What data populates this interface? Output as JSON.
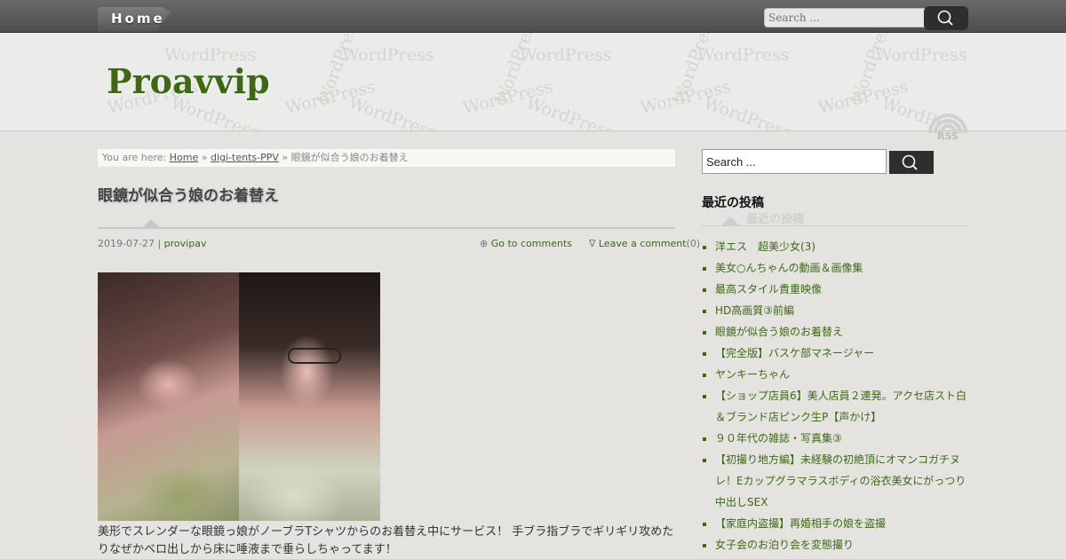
{
  "nav": {
    "home_label": "Home"
  },
  "top_search": {
    "placeholder": "Search ..."
  },
  "site": {
    "title": "Proavvip",
    "watermark": "WordPress",
    "rss_label": "RSS"
  },
  "breadcrumb": {
    "prefix": "You are here:",
    "home": "Home",
    "sep1": "»",
    "category": "digi-tents-PPV",
    "sep2": "»",
    "current": "眼鏡が似合う娘のお着替え"
  },
  "post": {
    "title": "眼鏡が似合う娘のお着替え",
    "date": "2019-07-27",
    "date_sep": "|",
    "author": "provipav",
    "goto_comments": "Go to comments",
    "leave_comment": "Leave a comment",
    "comment_count": "(0)",
    "body": "美形でスレンダーな眼鏡っ娘がノーブラTシャツからのお着替え中にサービス！ 手ブラ指ブラでギリギリ攻めたりなぜかベロ出しから床に唾液まで垂らしちゃってます！"
  },
  "sidebar": {
    "search_value": "Search ...",
    "recent_heading": "最近の投稿",
    "recent_heading_ghost": "最近の投稿",
    "recent_posts": [
      "洋エス　超美少女(3)",
      "美女○んちゃんの動画＆画像集",
      "最高スタイル貴重映像",
      "HD高画質③前編",
      "眼鏡が似合う娘のお着替え",
      "【完全版】バスケ部マネージャー",
      "ヤンキーちゃん",
      "【ショップ店員6】美人店員２連発。アクセ店スト白＆ブランド店ピンク生P【声かけ】",
      "９０年代の雑誌・写真集③",
      "【初撮り地方編】未経験の初絶頂にオマンコガチヌレ！Eカップグラマラスボディの浴衣美女にがっつり中出しSEX",
      "【家庭内盗撮】再婚相手の娘を盗撮",
      "女子会のお泊り会を変態撮り"
    ]
  },
  "icons": {
    "search": "search-icon",
    "rss": "rss-icon",
    "comment": "comment-icon",
    "reply": "reply-icon"
  },
  "colors": {
    "accent": "#3b6a13",
    "topbar": "#555555",
    "search_button": "#2e2e2e"
  }
}
